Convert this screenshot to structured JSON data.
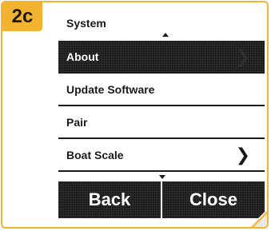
{
  "step": {
    "label": "2c"
  },
  "screen": {
    "title": "System",
    "menu": [
      {
        "label": "About",
        "selected": true,
        "has_chevron": true
      },
      {
        "label": "Update Software",
        "selected": false,
        "has_chevron": false
      },
      {
        "label": "Pair",
        "selected": false,
        "has_chevron": false
      },
      {
        "label": "Boat Scale",
        "selected": false,
        "has_chevron": true
      }
    ],
    "buttons": {
      "back": "Back",
      "close": "Close"
    }
  },
  "icons": {
    "scroll_up": "triangle-up-icon",
    "scroll_down": "triangle-down-icon",
    "chevron": "chevron-right-icon"
  },
  "colors": {
    "accent": "#f2b430",
    "dark": "#1c1c1c",
    "text": "#1a1a1a"
  }
}
